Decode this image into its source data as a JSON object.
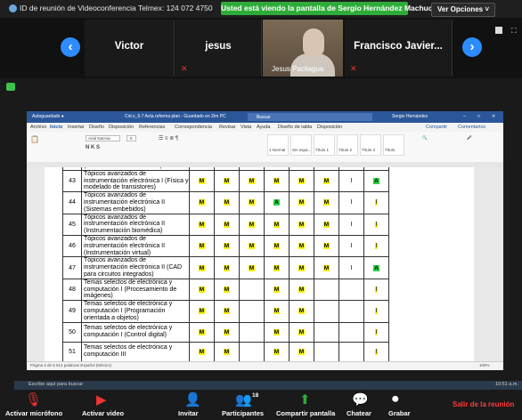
{
  "topbar": {
    "meeting_id": "ID de reunión de Videoconferencia Telmex: 124 072 4750",
    "share_banner": "Usted está viendo la pantalla de Sergio Hernández Machuca",
    "view_options": "Ver Opciones ˅"
  },
  "participants": [
    {
      "name": "Victor"
    },
    {
      "name": "jesus"
    },
    {
      "name": "Jesus Pacilagua"
    },
    {
      "name": "Francisco Javier..."
    }
  ],
  "word": {
    "title": "Cirt.x_6.7 Acta reforma plan - Guardado en Zim PC",
    "search": "Buscar",
    "user": "Sergio Hernández",
    "menu": [
      "Archivo",
      "Inicio",
      "Insertar",
      "Diseño",
      "Disposición",
      "Referencias",
      "Correspondencia",
      "Revisar",
      "Vista",
      "Ayuda",
      "Diseño de tabla",
      "Disposición"
    ],
    "share": "Compartir",
    "comments": "Comentarios",
    "font_name": "Arial Narrow",
    "font_size": "9",
    "styles": [
      "1 Normal",
      "Sin espa...",
      "Título 1",
      "Título 2",
      "Título 3",
      "Título"
    ],
    "status_left": "Página 4 de 5   514 palabras   Español (México)",
    "zoom": "100%",
    "rows": [
      {
        "num": "",
        "desc": "(Sistemas de comunicación)",
        "cells": [
          "",
          "",
          "",
          "",
          "",
          "",
          "",
          ""
        ]
      },
      {
        "num": "43",
        "desc": "Tópicos avanzados de instrumentación electrónica I (Física y modelado de transistores)",
        "cells": [
          "M",
          "M",
          "M",
          "M",
          "M",
          "M",
          "I",
          "A"
        ]
      },
      {
        "num": "44",
        "desc": "Tópicos avanzados de instrumentación electrónica II (Sistemas embebidos)",
        "cells": [
          "M",
          "M",
          "M",
          "A",
          "M",
          "M",
          "I",
          "I"
        ]
      },
      {
        "num": "45",
        "desc": "Tópicos avanzados de instrumentación electrónica II (Instrumentación biomédica)",
        "cells": [
          "M",
          "M",
          "M",
          "M",
          "M",
          "M",
          "I",
          "I"
        ]
      },
      {
        "num": "46",
        "desc": "Tópicos avanzados de instrumentación electrónica II (Instrumentación virtual)",
        "cells": [
          "M",
          "M",
          "M",
          "M",
          "M",
          "M",
          "I",
          "I"
        ]
      },
      {
        "num": "47",
        "desc": "Tópicos avanzados de instrumentación electrónica II (CAD para circuitos integrados)",
        "cells": [
          "M",
          "M",
          "M",
          "M",
          "M",
          "M",
          "I",
          "A"
        ]
      },
      {
        "num": "48",
        "desc": "Temas selectos de electrónica y computación I (Procesamiento de imágenes)",
        "cells": [
          "M",
          "M",
          "",
          "M",
          "M",
          "",
          "",
          "I"
        ]
      },
      {
        "num": "49",
        "desc": "Temas selectos de electrónica y computación I (Programación orientada a objetos)",
        "cells": [
          "M",
          "M",
          "",
          "M",
          "M",
          "",
          "",
          "I"
        ]
      },
      {
        "num": "50",
        "desc": "Temas selectos de electrónica y computación I (Control digital)",
        "cells": [
          "M",
          "M",
          "",
          "M",
          "M",
          "",
          "",
          "I"
        ]
      },
      {
        "num": "51",
        "desc": "Temas selectos de electrónica y computación III",
        "cells": [
          "M",
          "M",
          "",
          "M",
          "M",
          "",
          "",
          "I"
        ]
      }
    ]
  },
  "taskbar": {
    "search": "Escribe aquí para buscar",
    "time": "10:51 a.m."
  },
  "bottom": {
    "mic": "Activar micrófono",
    "video": "Activar video",
    "invite": "Invitar",
    "participants": "Participantes",
    "participant_count": "18",
    "share": "Compartir pantalla",
    "chat": "Chatear",
    "record": "Grabar",
    "leave": "Salir de la reunión"
  }
}
